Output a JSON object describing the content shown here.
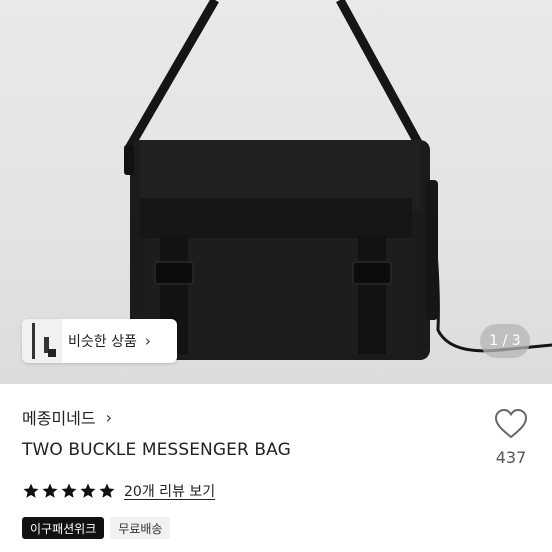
{
  "gallery": {
    "similar_products_label": "비슷한 상품",
    "chevron": "›",
    "page_indicator": "1 / 3"
  },
  "product": {
    "brand": "메종미네드",
    "brand_chevron": "›",
    "title": "TWO BUCKLE MESSENGER BAG",
    "rating": 5,
    "review_link": "20개 리뷰 보기",
    "badges": [
      "이구패션위크",
      "무료배송"
    ],
    "like_count": "437"
  },
  "icons": {
    "star": "star-icon",
    "heart": "heart-outline-icon",
    "chevron": "chevron-right-icon"
  },
  "colors": {
    "star": "#111111",
    "badge_dark": "#111111",
    "badge_light": "#f1f1f1"
  }
}
